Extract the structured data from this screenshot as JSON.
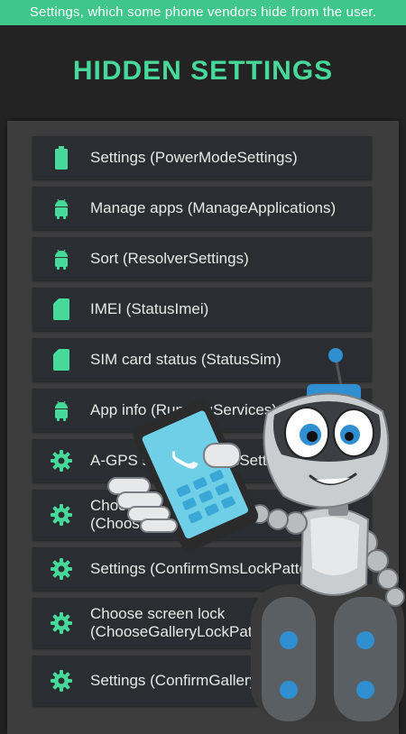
{
  "banner": {
    "text": "Settings, which some phone vendors hide from the user."
  },
  "header": {
    "title": "HIDDEN SETTINGS"
  },
  "colors": {
    "accent": "#46d99a",
    "item_bg": "#2a2e32",
    "panel_bg": "#3d3d3d"
  },
  "items": [
    {
      "icon": "battery-icon",
      "label": "Settings (PowerModeSettings)"
    },
    {
      "icon": "android-icon",
      "label": "Manage apps (ManageApplications)"
    },
    {
      "icon": "android-icon",
      "label": "Sort (ResolverSettings)"
    },
    {
      "icon": "sim-card-icon",
      "label": "IMEI (StatusImei)"
    },
    {
      "icon": "sim-card-icon",
      "label": "SIM card status (StatusSim)"
    },
    {
      "icon": "android-icon",
      "label": "App info (RunningServices)"
    },
    {
      "icon": "gear-icon",
      "label": "A-GPS settings (AgpsSettings)"
    },
    {
      "icon": "gear-icon",
      "label": "Choose screen lock (ChooseLockPattern)"
    },
    {
      "icon": "gear-icon",
      "label": "Settings (ConfirmSmsLockPattern)"
    },
    {
      "icon": "gear-icon",
      "label": "Choose screen lock (ChooseGalleryLockPattern)"
    },
    {
      "icon": "gear-icon",
      "label": "Settings (ConfirmGalleryLockPattern)"
    }
  ]
}
